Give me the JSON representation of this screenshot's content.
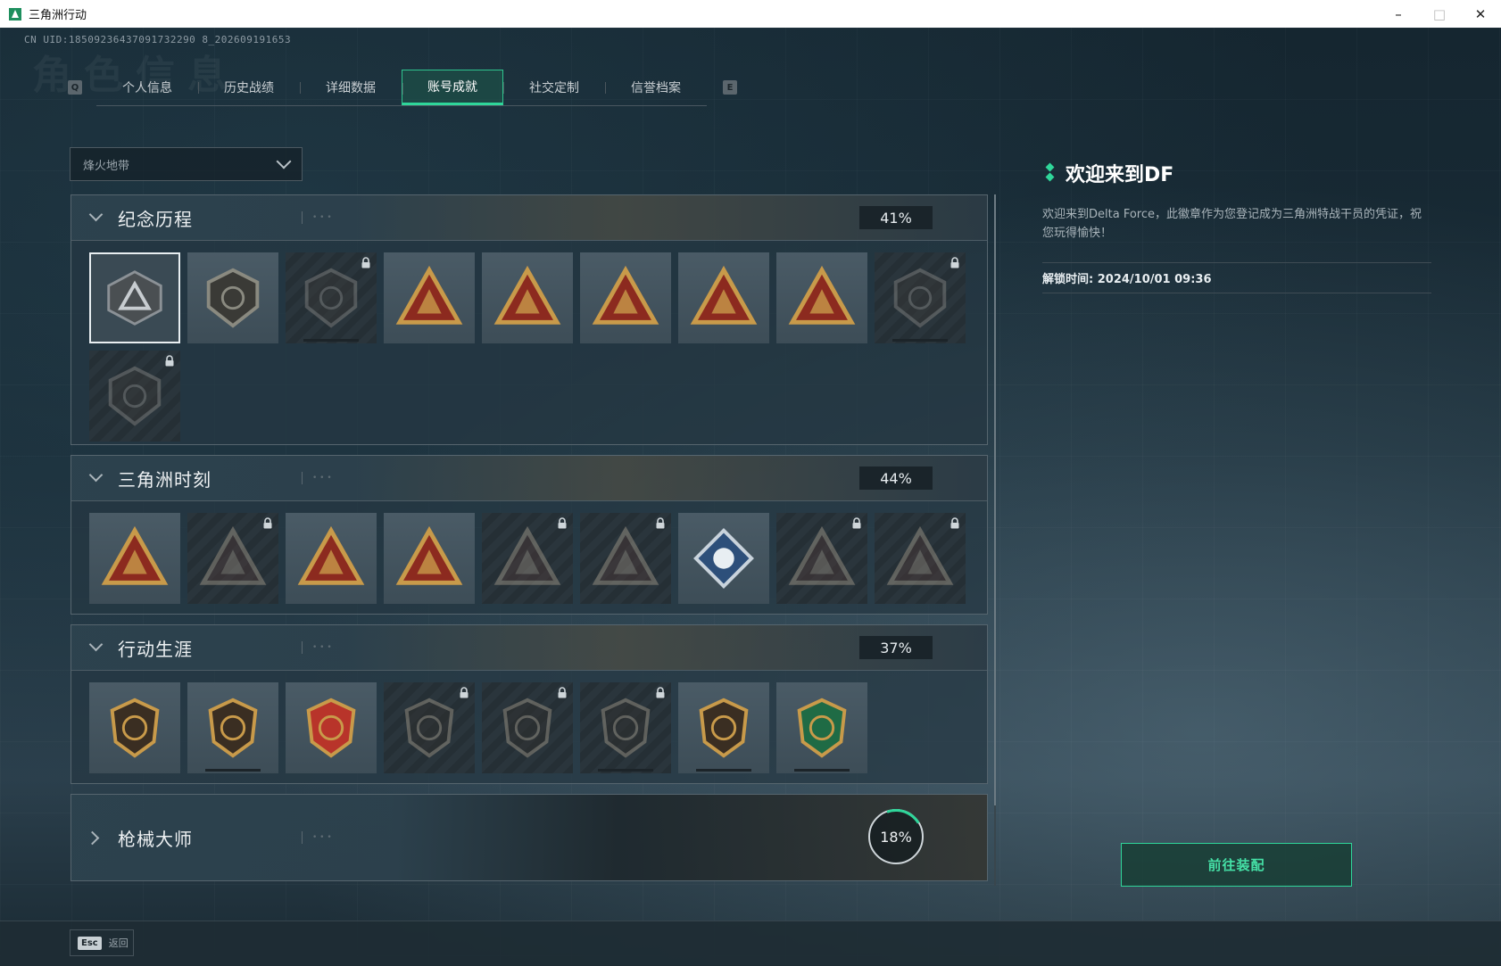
{
  "window": {
    "title": "三角洲行动",
    "minimize": "–",
    "maximize": "□",
    "close": "✕"
  },
  "uid": "CN UID:18509236437091732290 8_202609191653",
  "ghost_title": "角色信息",
  "tabs": {
    "left_key": "Q",
    "right_key": "E",
    "items": [
      {
        "label": "个人信息"
      },
      {
        "label": "历史战绩"
      },
      {
        "label": "详细数据"
      },
      {
        "label": "账号成就",
        "active": true
      },
      {
        "label": "社交定制"
      },
      {
        "label": "信誉档案"
      }
    ]
  },
  "dropdown": {
    "value": "烽火地带"
  },
  "sections": [
    {
      "title": "纪念历程",
      "percent": "41%",
      "expanded": true
    },
    {
      "title": "三角洲时刻",
      "percent": "44%",
      "expanded": true
    },
    {
      "title": "行动生涯",
      "percent": "37%",
      "expanded": true
    },
    {
      "title": "枪械大师",
      "percent": "18%",
      "expanded": false,
      "progress": 0.18
    }
  ],
  "badge_icons": {
    "s1": [
      "triangle-logo-emblem",
      "helicopter-emblem",
      "shield-locked-emblem",
      "badge-58-emblem",
      "badge-s11-emblem",
      "hand-heart-emblem",
      "number-1-emblem",
      "number-2-emblem",
      "anniversary-locked-emblem",
      "globe-2025-locked-emblem"
    ],
    "s1_locked": [
      false,
      false,
      true,
      false,
      false,
      false,
      false,
      false,
      true,
      true
    ],
    "s2": [
      "usb-drive-emblem",
      "soldier-locked-emblem",
      "hexagram-emblem",
      "squad-emblem",
      "tank-locked-emblem",
      "arrow-locked-emblem",
      "rose-emblem",
      "eagle-locked-emblem",
      "skull-locked-emblem"
    ],
    "s2_locked": [
      false,
      true,
      false,
      false,
      true,
      true,
      false,
      true,
      true
    ],
    "s3": [
      "star-medal-emblem",
      "shield-medal-emblem",
      "eagle-medal-emblem",
      "hex-locked-emblem",
      "ring-locked-emblem",
      "crosshair-locked-emblem",
      "eye-medal-emblem",
      "green-dragon-emblem"
    ],
    "s3_locked": [
      false,
      false,
      false,
      true,
      true,
      true,
      false,
      false
    ]
  },
  "colors": {
    "accent": "#2fd69a",
    "gold": "#c89a4a",
    "red": "#8c2a1f"
  },
  "panel": {
    "title": "欢迎来到DF",
    "description": "欢迎来到Delta Force，此徽章作为您登记成为三角洲特战干员的凭证，祝您玩得愉快！",
    "unlock_time": "解锁时间: 2024/10/01 09:36",
    "equip_button": "前往装配"
  },
  "footer": {
    "esc_key": "Esc",
    "back_label": "返回"
  }
}
